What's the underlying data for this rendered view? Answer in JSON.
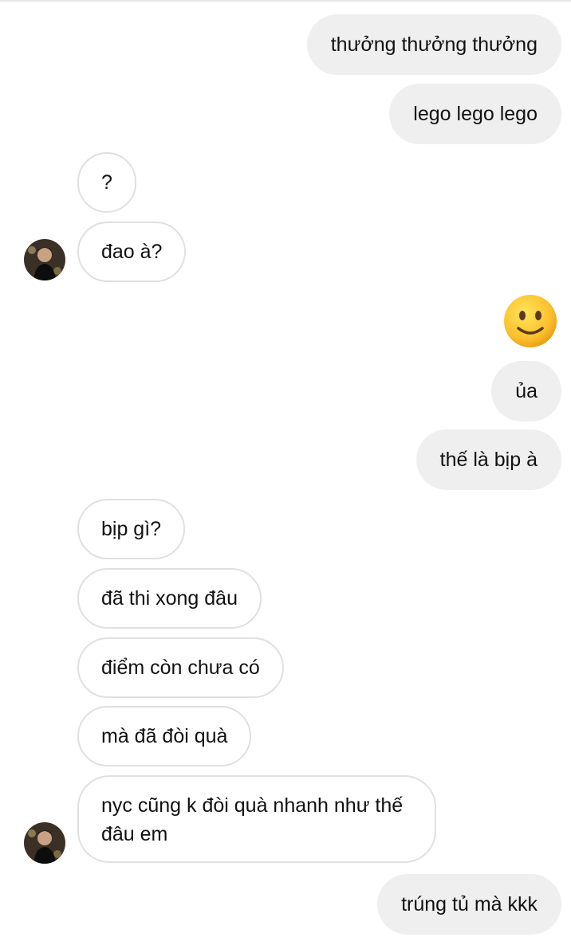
{
  "messages": [
    {
      "side": "sent",
      "text": "thưởng thưởng thưởng"
    },
    {
      "side": "sent",
      "text": "lego lego lego"
    },
    {
      "side": "received",
      "text": "?"
    },
    {
      "side": "received",
      "text": "đao à?"
    },
    {
      "side": "sent",
      "type": "emoji",
      "icon": "slightly-smiling-face"
    },
    {
      "side": "sent",
      "text": "ủa"
    },
    {
      "side": "sent",
      "text": "thế là bịp à"
    },
    {
      "side": "received",
      "text": "bịp gì?"
    },
    {
      "side": "received",
      "text": "đã thi xong đâu"
    },
    {
      "side": "received",
      "text": "điểm còn chưa có"
    },
    {
      "side": "received",
      "text": "mà đã đòi quà"
    },
    {
      "side": "received",
      "text": "nyc cũng k đòi quà nhanh như thế đâu em"
    },
    {
      "side": "sent",
      "text": "trúng tủ mà kkk"
    }
  ],
  "colors": {
    "sent_bubble": "#efefef",
    "received_border": "#e0e0e0",
    "text": "#111111"
  }
}
